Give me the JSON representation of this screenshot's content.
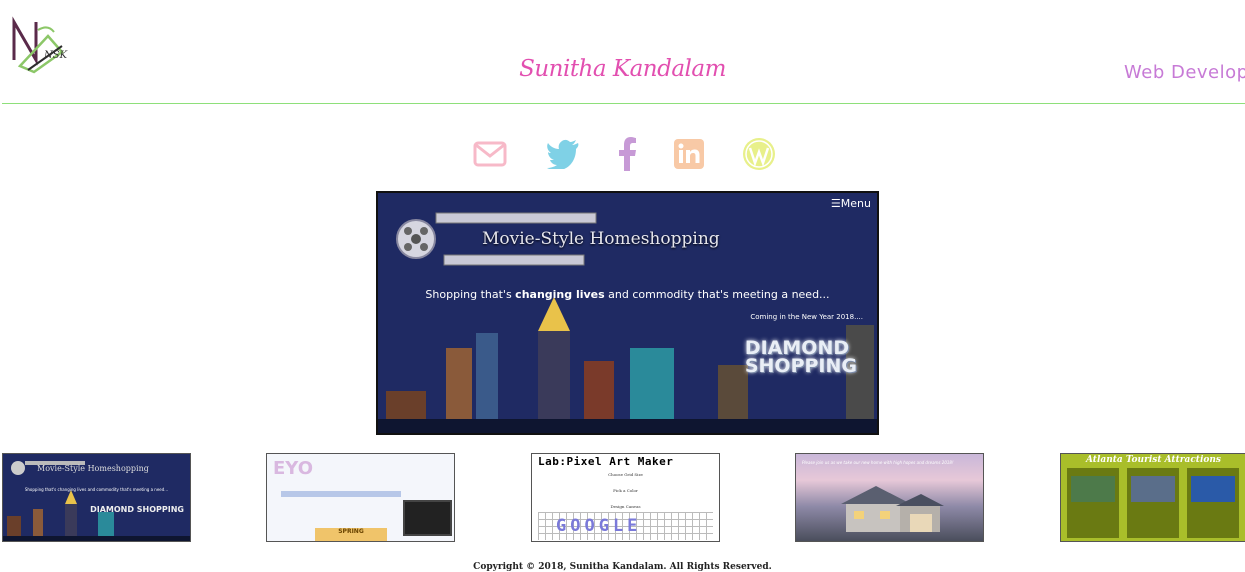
{
  "header": {
    "logo_text": "NSK",
    "name": "Sunitha Kandalam",
    "role": "Web Developer"
  },
  "social": [
    {
      "icon": "envelope-icon",
      "color": "#f7b9c8"
    },
    {
      "icon": "twitter-icon",
      "color": "#7fd1e6"
    },
    {
      "icon": "facebook-icon",
      "color": "#c79ad6"
    },
    {
      "icon": "linkedin-icon",
      "color": "#f8c9a6"
    },
    {
      "icon": "wordpress-icon",
      "color": "#e8f08a"
    }
  ],
  "hero": {
    "menu_label": "☰Menu",
    "brand": "Movie-Style Homeshopping",
    "tagline_pre": "Shopping that's ",
    "tagline_bold": "changing lives",
    "tagline_post": " and commodity that's meeting a need...",
    "coming": "Coming in the New Year 2018....",
    "diamond_line1": "DIAMOND",
    "diamond_line2": "SHOPPING"
  },
  "thumbnails": {
    "t1": {
      "brand": "Movie-Style Homeshopping",
      "tagline": "Shopping that's changing lives and commodity that's meeting a need...",
      "diamond": "DIAMOND SHOPPING"
    },
    "t2": {
      "logo": "EYO",
      "promo": "SPRING"
    },
    "t3": {
      "heading": "Lab:Pixel Art Maker",
      "l1": "Choose Grid Size",
      "l2": "Pick a Color",
      "l3": "Design Canvas",
      "art": "GOOGLE"
    },
    "t4": {
      "quote": "Please join us as we take our new home with high hopes and dreams 2018!"
    },
    "t5": {
      "heading": "Atlanta Tourist Attractions"
    }
  },
  "footer": {
    "copyright": "Copyright © 2018, Sunitha Kandalam. All Rights Reserved."
  }
}
